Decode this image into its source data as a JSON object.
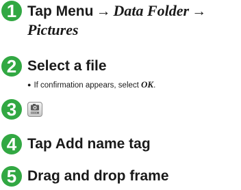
{
  "steps": [
    {
      "number": "1",
      "part1": "Tap Menu",
      "arrow1": "→",
      "part2": "Data Folder",
      "arrow2": "→",
      "part3": "Pictures"
    },
    {
      "number": "2",
      "label": "Select a file",
      "note_bullet": "●",
      "note_text": "If confirmation appears, select ",
      "note_emphasis": "OK",
      "note_end": "."
    },
    {
      "number": "3",
      "icon": "camera-edit-icon"
    },
    {
      "number": "4",
      "label": "Tap Add name tag"
    },
    {
      "number": "5",
      "label": "Drag and drop frame"
    }
  ],
  "colors": {
    "badge": "#32a843",
    "text": "#1a1a1a"
  }
}
